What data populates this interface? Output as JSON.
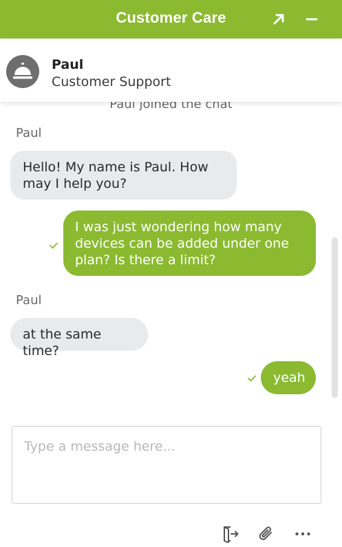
{
  "header": {
    "title": "Customer Care",
    "expand_icon": "arrow-up-right-icon",
    "minimize_icon": "minus-icon",
    "background_color": "#8bba31"
  },
  "agent": {
    "name": "Paul",
    "role": "Customer Support",
    "avatar_icon": "service-bell-icon"
  },
  "conversation": {
    "system_message": "Paul joined the chat",
    "messages": [
      {
        "sender": "Paul",
        "side": "agent",
        "lines": [
          "Hello! My name is Paul. How",
          "may I help you?"
        ]
      },
      {
        "sender": "me",
        "side": "user",
        "status": "delivered",
        "lines": [
          "I was just wondering how many",
          "devices can be added under one",
          "plan? Is there a limit?"
        ]
      },
      {
        "sender": "Paul",
        "side": "agent",
        "lines": [
          "at the same time?"
        ]
      },
      {
        "sender": "me",
        "side": "user",
        "status": "delivered",
        "lines": [
          "yeah"
        ]
      }
    ]
  },
  "composer": {
    "placeholder": "Type a message here..."
  },
  "toolbar": {
    "items": [
      {
        "icon": "exit-chat-icon"
      },
      {
        "icon": "paperclip-icon"
      },
      {
        "icon": "more-dots-icon"
      }
    ]
  },
  "colors": {
    "accent": "#8bba31",
    "agent_bubble": "#e9eaec",
    "check": "#8bba31"
  }
}
